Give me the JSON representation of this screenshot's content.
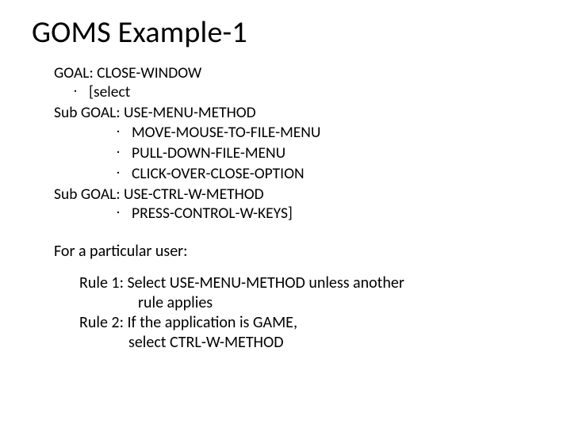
{
  "title": "GOMS Example-1",
  "goms": {
    "goal": "GOAL: CLOSE-WINDOW",
    "select": "[select",
    "sub1": "Sub GOAL: USE-MENU-METHOD",
    "sub1_ops": [
      "MOVE-MOUSE-TO-FILE-MENU",
      "PULL-DOWN-FILE-MENU",
      "CLICK-OVER-CLOSE-OPTION"
    ],
    "sub2": "Sub GOAL: USE-CTRL-W-METHOD",
    "sub2_op": "PRESS-CONTROL-W-KEYS]"
  },
  "usernote": "For a particular user:",
  "rules": {
    "r1a": "Rule 1: Select USE-MENU-METHOD unless another",
    "r1b": "rule applies",
    "r2a": "Rule 2: If the application is GAME,",
    "r2b": "select CTRL-W-METHOD"
  }
}
